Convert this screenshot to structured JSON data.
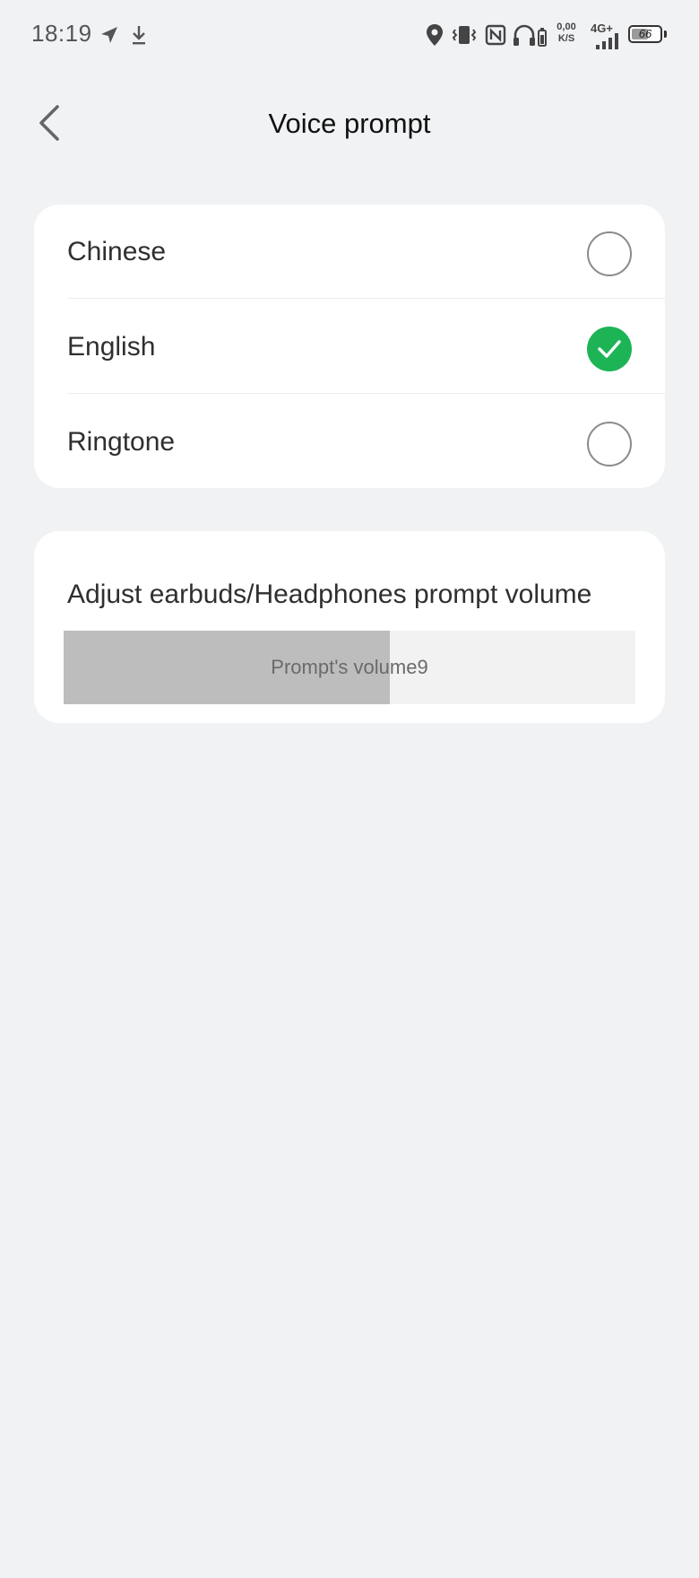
{
  "status_bar": {
    "time": "18:19",
    "icons": [
      "navigation-arrow-icon",
      "download-icon",
      "location-pin-icon",
      "vibrate-icon",
      "nfc-icon",
      "headphones-battery-icon",
      "signal-bars-icon"
    ],
    "speed_value": "0,00",
    "speed_unit": "K/S",
    "network_type": "4G+",
    "battery_level": "66",
    "battery_percent": 66
  },
  "header": {
    "title": "Voice prompt",
    "back_icon": "chevron-left-icon"
  },
  "options": {
    "items": [
      {
        "label": "Chinese",
        "selected": false
      },
      {
        "label": "English",
        "selected": true
      },
      {
        "label": "Ringtone",
        "selected": false
      }
    ]
  },
  "volume": {
    "title": "Adjust earbuds/Headphones prompt volume",
    "label": "Prompt's volume9",
    "level_fraction": 0.57
  },
  "colors": {
    "background": "#f1f2f4",
    "card": "#ffffff",
    "selected": "#1db456",
    "slider_fill": "#bdbdbd",
    "slider_track": "#f2f2f2"
  }
}
